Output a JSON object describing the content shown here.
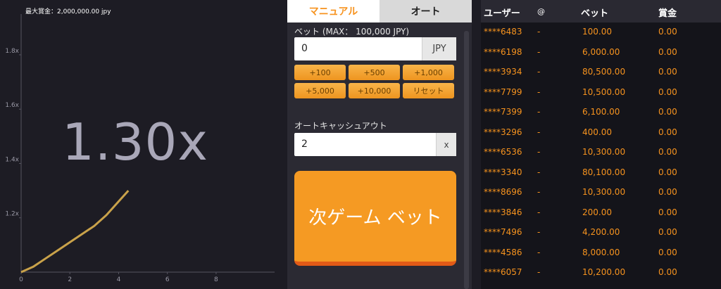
{
  "graph": {
    "max_prize_label": "最大賞金：2,000,000.00 jpy",
    "multiplier": "1.30x",
    "y_ticks": [
      "1.8x",
      "1.6x",
      "1.4x",
      "1.2x"
    ],
    "x_ticks": [
      "0",
      "2",
      "4",
      "6",
      "8"
    ],
    "line_color": "#c9a24a"
  },
  "chart_data": {
    "type": "line",
    "title": "",
    "xlabel": "",
    "ylabel": "",
    "xlim": [
      0,
      10.4
    ],
    "ylim": [
      1.0,
      1.95
    ],
    "x": [
      0,
      0.5,
      1,
      1.5,
      2,
      2.5,
      3,
      3.5,
      4,
      4.4
    ],
    "y": [
      1.0,
      1.02,
      1.05,
      1.08,
      1.11,
      1.14,
      1.17,
      1.21,
      1.26,
      1.3
    ]
  },
  "bet_panel": {
    "tabs": [
      {
        "label": "マニュアル",
        "active": true
      },
      {
        "label": "オート",
        "active": false
      }
    ],
    "bet_label": "ベット (MAX： 100,000 JPY)",
    "bet_value": "0",
    "bet_currency": "JPY",
    "quick_buttons": [
      "+100",
      "+500",
      "+1,000",
      "+5,000",
      "+10,000",
      "リセット"
    ],
    "auto_cashout_label": "オートキャッシュアウト",
    "auto_cashout_value": "2",
    "auto_cashout_suffix": "x",
    "next_bet_button": "次ゲーム ベット"
  },
  "bets_table": {
    "headers": [
      "ユーザー",
      "@",
      "ベット",
      "賞金"
    ],
    "rows": [
      {
        "user": "****6483",
        "at": "-",
        "bet": "100.00",
        "prize": "0.00"
      },
      {
        "user": "****6198",
        "at": "-",
        "bet": "6,000.00",
        "prize": "0.00"
      },
      {
        "user": "****3934",
        "at": "-",
        "bet": "80,500.00",
        "prize": "0.00"
      },
      {
        "user": "****7799",
        "at": "-",
        "bet": "10,500.00",
        "prize": "0.00"
      },
      {
        "user": "****7399",
        "at": "-",
        "bet": "6,100.00",
        "prize": "0.00"
      },
      {
        "user": "****3296",
        "at": "-",
        "bet": "400.00",
        "prize": "0.00"
      },
      {
        "user": "****6536",
        "at": "-",
        "bet": "10,300.00",
        "prize": "0.00"
      },
      {
        "user": "****3340",
        "at": "-",
        "bet": "80,100.00",
        "prize": "0.00"
      },
      {
        "user": "****8696",
        "at": "-",
        "bet": "10,300.00",
        "prize": "0.00"
      },
      {
        "user": "****3846",
        "at": "-",
        "bet": "200.00",
        "prize": "0.00"
      },
      {
        "user": "****7496",
        "at": "-",
        "bet": "4,200.00",
        "prize": "0.00"
      },
      {
        "user": "****4586",
        "at": "-",
        "bet": "8,000.00",
        "prize": "0.00"
      },
      {
        "user": "****6057",
        "at": "-",
        "bet": "10,200.00",
        "prize": "0.00"
      }
    ]
  }
}
